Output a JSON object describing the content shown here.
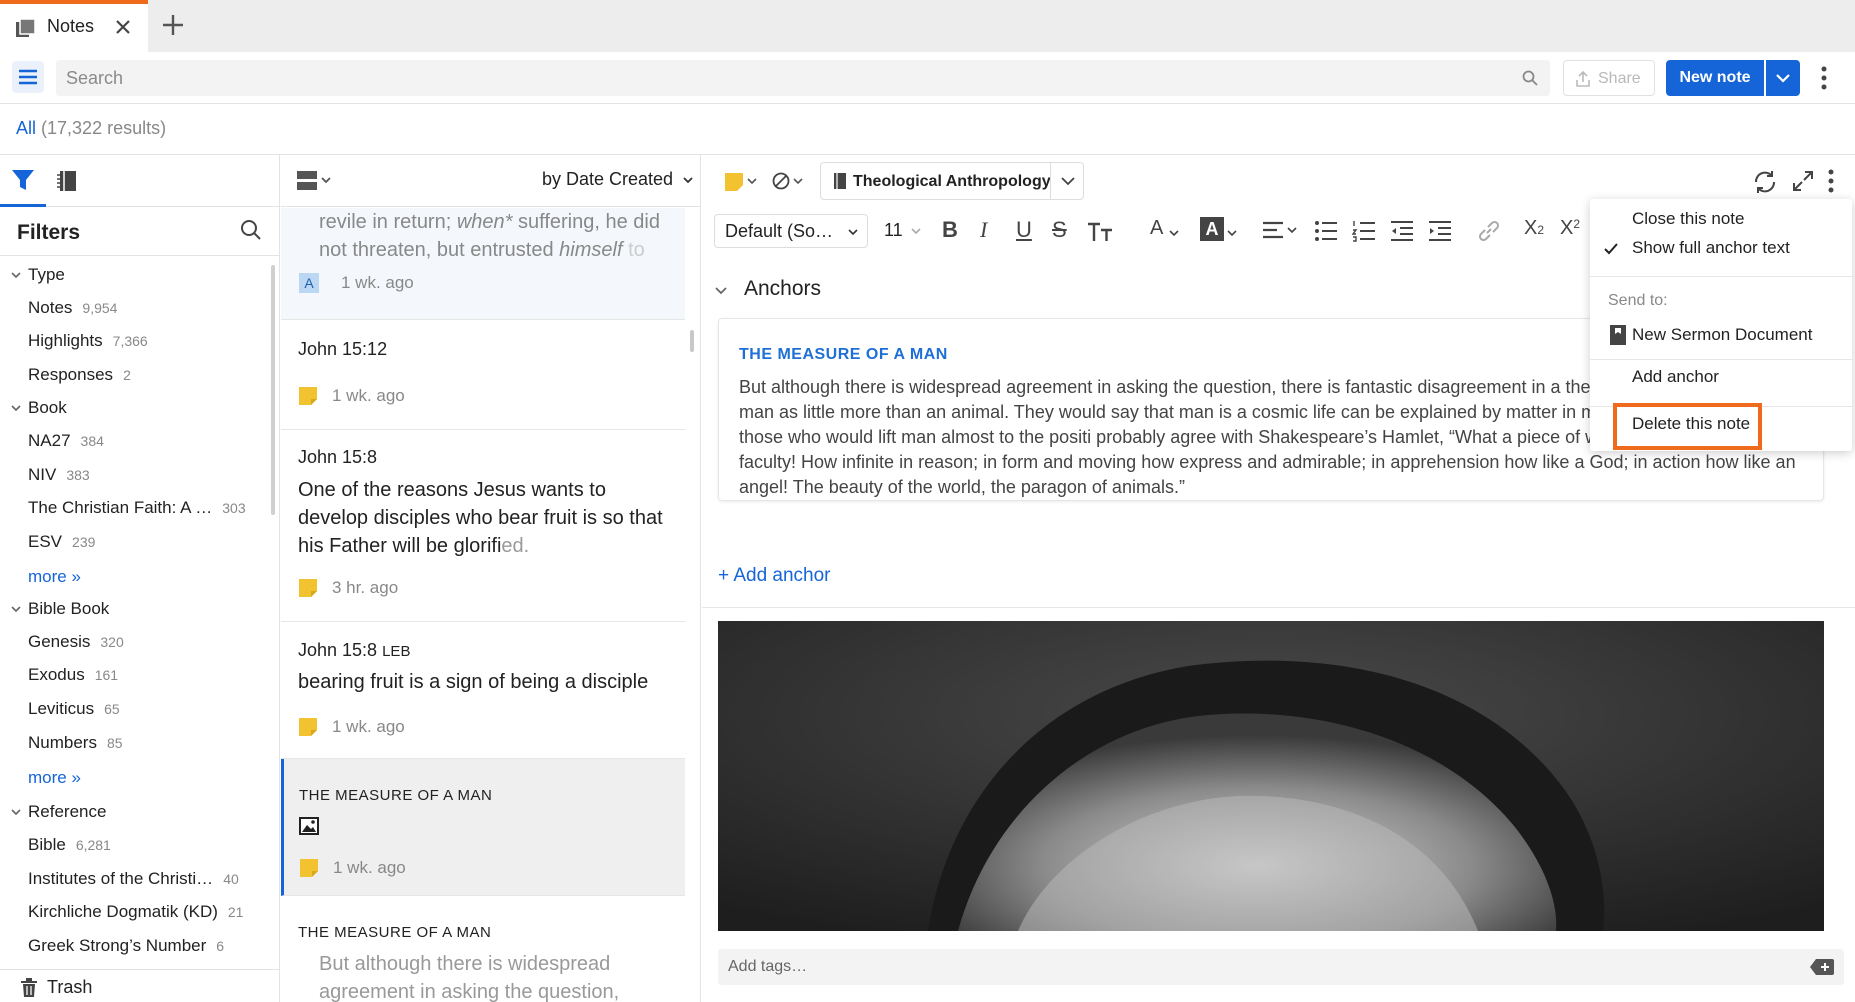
{
  "tab": {
    "label": "Notes"
  },
  "toolbar": {
    "search_placeholder": "Search",
    "share_label": "Share",
    "new_note_label": "New note"
  },
  "results": {
    "all_label": "All",
    "count": "(17,322 results)"
  },
  "filters": {
    "title": "Filters",
    "groups": [
      {
        "label": "Type",
        "items": [
          {
            "label": "Notes",
            "count": "9,954"
          },
          {
            "label": "Highlights",
            "count": "7,366"
          },
          {
            "label": "Responses",
            "count": "2"
          }
        ]
      },
      {
        "label": "Book",
        "items": [
          {
            "label": "NA27",
            "count": "384"
          },
          {
            "label": "NIV",
            "count": "383"
          },
          {
            "label": "The Christian Faith: A …",
            "count": "303"
          },
          {
            "label": "ESV",
            "count": "239"
          }
        ],
        "more": "more »"
      },
      {
        "label": "Bible Book",
        "items": [
          {
            "label": "Genesis",
            "count": "320"
          },
          {
            "label": "Exodus",
            "count": "161"
          },
          {
            "label": "Leviticus",
            "count": "65"
          },
          {
            "label": "Numbers",
            "count": "85"
          }
        ],
        "more": "more »"
      },
      {
        "label": "Reference",
        "items": [
          {
            "label": "Bible",
            "count": "6,281"
          },
          {
            "label": "Institutes of the Christi…",
            "count": "40"
          },
          {
            "label": "Kirchliche Dogmatik (KD)",
            "count": "21"
          },
          {
            "label": "Greek Strong’s Number",
            "count": "6"
          }
        ]
      }
    ],
    "trash_label": "Trash"
  },
  "note_list": {
    "sort_label": "by Date Created",
    "cards": [
      {
        "body_normal": "revile in return; ",
        "body_italic": "when*",
        "body_tail": " suffering, he did not threaten, but entrusted ",
        "body_italic2": "himself",
        "body_fade": " to",
        "time": "1 wk. ago",
        "badge": "A"
      },
      {
        "ref": "John 15:12",
        "time": "1 wk. ago"
      },
      {
        "ref": "John 15:8",
        "body": "One of the reasons Jesus wants to develop disciples who bear fruit is so that his Father will be glorifi",
        "body_fade": "ed.",
        "time": "3 hr. ago"
      },
      {
        "ref": "John 15:8",
        "ref_version": "LEB",
        "body": "bearing fruit is a sign of being a disciple",
        "time": "1 wk. ago"
      },
      {
        "ref": "THE MEASURE OF A MAN",
        "time": "1 wk. ago"
      },
      {
        "ref": "THE MEASURE OF A MAN",
        "body": "But although there is widespread agreement in asking the question,"
      }
    ]
  },
  "editor": {
    "notebook": "Theological Anthropology",
    "font": "Default (So…",
    "font_size": "11",
    "anchors_label": "Anchors",
    "anchor_title": "THE MEASURE OF A MAN",
    "anchor_text": "But although there is widespread agreement in asking the question, there is fantastic disagreement in a there are those who look upon man as little more than an animal. They would say that man is a cosmic life can be explained by matter in motion. Then there are those who would lift man almost to the positi probably agree with Shakespeare’s Hamlet, “What a piece of work is man! How noble in faculty! How infinite in reason; in form and moving how express and admirable; in apprehension how like a God; in action how like an angel! The beauty of the world, the paragon of animals.”",
    "add_anchor": "+ Add anchor",
    "tags_placeholder": "Add tags…"
  },
  "context_menu": {
    "close": "Close this note",
    "show_full": "Show full anchor text",
    "send_to": "Send to:",
    "sermon": "New Sermon Document",
    "add_anchor": "Add anchor",
    "delete": "Delete this note"
  },
  "colors": {
    "accent": "#1565d8",
    "highlight_box": "#ef6a1d",
    "note_yellow": "#f2c230"
  }
}
